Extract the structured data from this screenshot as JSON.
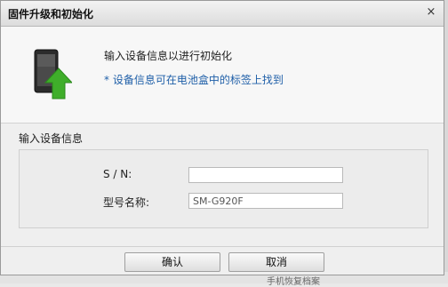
{
  "dialog": {
    "title": "固件升级和初始化",
    "close_symbol": "×"
  },
  "info": {
    "heading": "输入设备信息以进行初始化",
    "hint": "* 设备信息可在电池盒中的标签上找到",
    "icon": "phone-upgrade-icon"
  },
  "form": {
    "section_label": "输入设备信息",
    "sn_label": "S / N:",
    "sn_value": "",
    "model_label": "型号名称:",
    "model_value": "SM-G920F"
  },
  "buttons": {
    "ok": "确认",
    "cancel": "取消"
  },
  "background": {
    "partial_text": "手机恢复档案"
  },
  "colors": {
    "hint": "#1f5fa8",
    "arrow": "#3fae2a"
  }
}
